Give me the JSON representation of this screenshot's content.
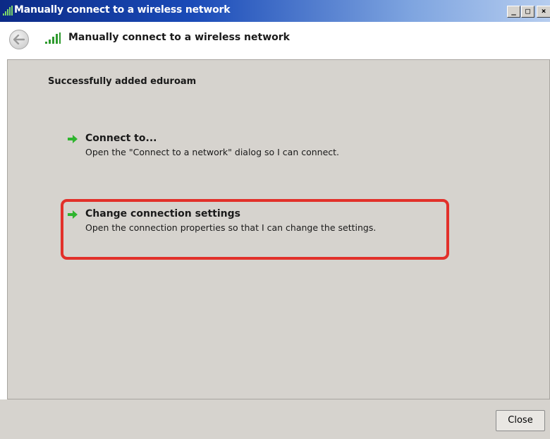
{
  "window": {
    "title": "Manually connect to a wireless network",
    "buttons": {
      "minimize": "_",
      "maximize": "□",
      "close": "×"
    }
  },
  "nav": {
    "back_icon": "back-arrow-icon",
    "network_icon": "wireless-signal-icon",
    "title": "Manually connect to a wireless network"
  },
  "content": {
    "success_message": "Successfully added eduroam",
    "options": [
      {
        "icon": "green-arrow-icon",
        "title": "Connect to...",
        "description": "Open the \"Connect to a network\" dialog so I can connect."
      },
      {
        "icon": "green-arrow-icon",
        "title": "Change connection settings",
        "description": "Open the connection properties so that I can change the settings."
      }
    ],
    "highlight_color": "#e2302a"
  },
  "footer": {
    "close_label": "Close"
  },
  "colors": {
    "titlebar_start": "#0c2a86",
    "panel": "#d6d3ce",
    "arrow_green": "#2fb52f"
  }
}
